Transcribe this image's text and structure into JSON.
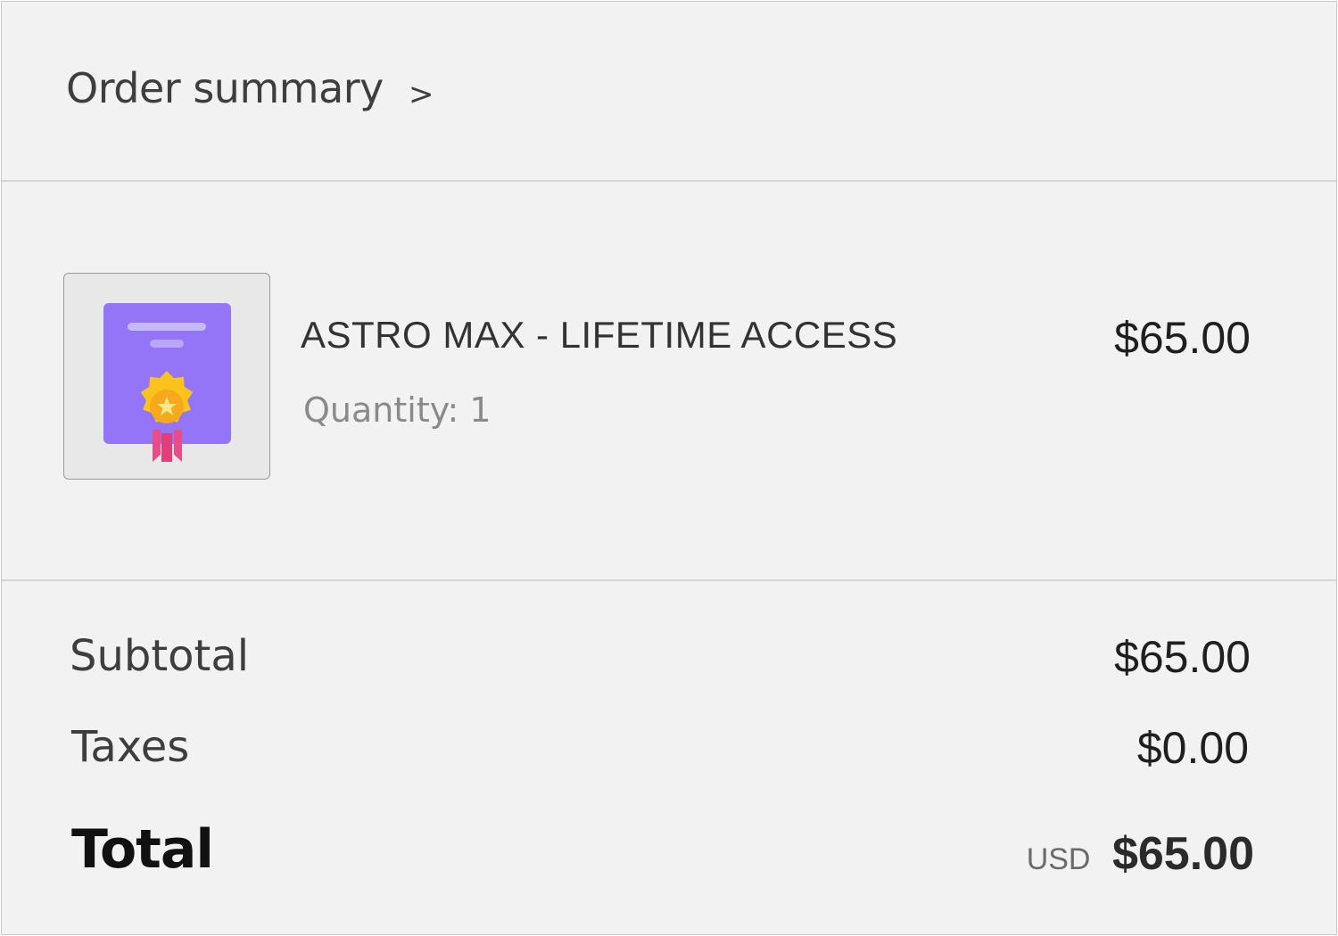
{
  "header": {
    "title": "Order summary",
    "chevron": ">"
  },
  "item": {
    "icon": "certificate-icon",
    "name": "ASTRO MAX - LIFETIME ACCESS",
    "quantity_text": "Quantity: 1",
    "price": "$65.00"
  },
  "totals": {
    "subtotal_label": "Subtotal",
    "subtotal_value": "$65.00",
    "taxes_label": "Taxes",
    "taxes_value": "$0.00",
    "total_label": "Total",
    "currency": "USD",
    "total_value": "$65.00"
  },
  "colors": {
    "certificate": "#9475f7",
    "seal": "#f9c31c",
    "ribbon": "#ea4c89",
    "background": "#f2f2f2"
  }
}
